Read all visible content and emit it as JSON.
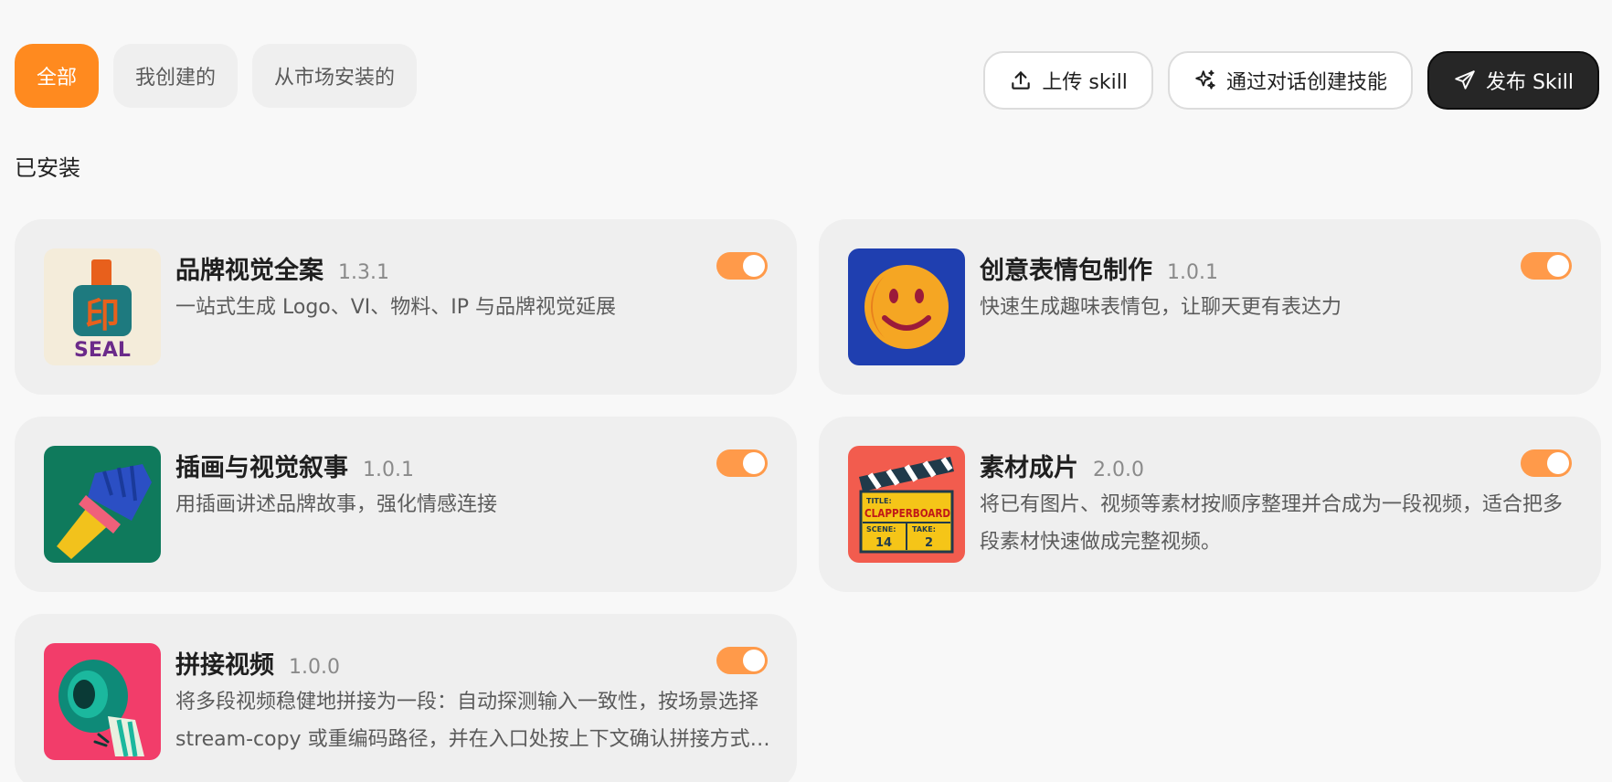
{
  "filters": {
    "tabs": [
      {
        "label": "全部",
        "active": true
      },
      {
        "label": "我创建的",
        "active": false
      },
      {
        "label": "从市场安装的",
        "active": false
      }
    ]
  },
  "actions": {
    "upload_label": "上传 skill",
    "create_chat_label": "通过对话创建技能",
    "publish_label": "发布 Skill"
  },
  "section": {
    "title": "已安装"
  },
  "skills": [
    {
      "name": "品牌视觉全案",
      "version": "1.3.1",
      "description": "一站式生成 Logo、VI、物料、IP 与品牌视觉延展",
      "enabled": true,
      "icon": "seal-stamp-icon",
      "icon_text": [
        "印",
        "SEAL"
      ]
    },
    {
      "name": "创意表情包制作",
      "version": "1.0.1",
      "description": "快速生成趣味表情包，让聊天更有表达力",
      "enabled": true,
      "icon": "smiley-face-icon"
    },
    {
      "name": "插画与视觉叙事",
      "version": "1.0.1",
      "description": "用插画讲述品牌故事，强化情感连接",
      "enabled": true,
      "icon": "paintbrush-icon"
    },
    {
      "name": "素材成片",
      "version": "2.0.0",
      "description": "将已有图片、视频等素材按顺序整理并合成为一段视频，适合把多段素材快速做成完整视频。",
      "enabled": true,
      "icon": "clapperboard-icon",
      "icon_text": [
        "TITLE:",
        "CLAPPERBOARD",
        "SCENE:",
        "TAKE:",
        "14",
        "2"
      ]
    },
    {
      "name": "拼接视频",
      "version": "1.0.0",
      "description": "将多段视频稳健地拼接为一段：自动探测输入一致性，按场景选择 stream-copy 或重编码路径，并在入口处按上下文确认拼接方式与输出参数。",
      "enabled": true,
      "icon": "film-tape-icon"
    }
  ],
  "colors": {
    "accent": "#ff8a1f",
    "toggle_on": "#ff9a4a",
    "dark_button": "#262626",
    "card_bg": "#efefef",
    "page_bg": "#f8f8f8"
  }
}
